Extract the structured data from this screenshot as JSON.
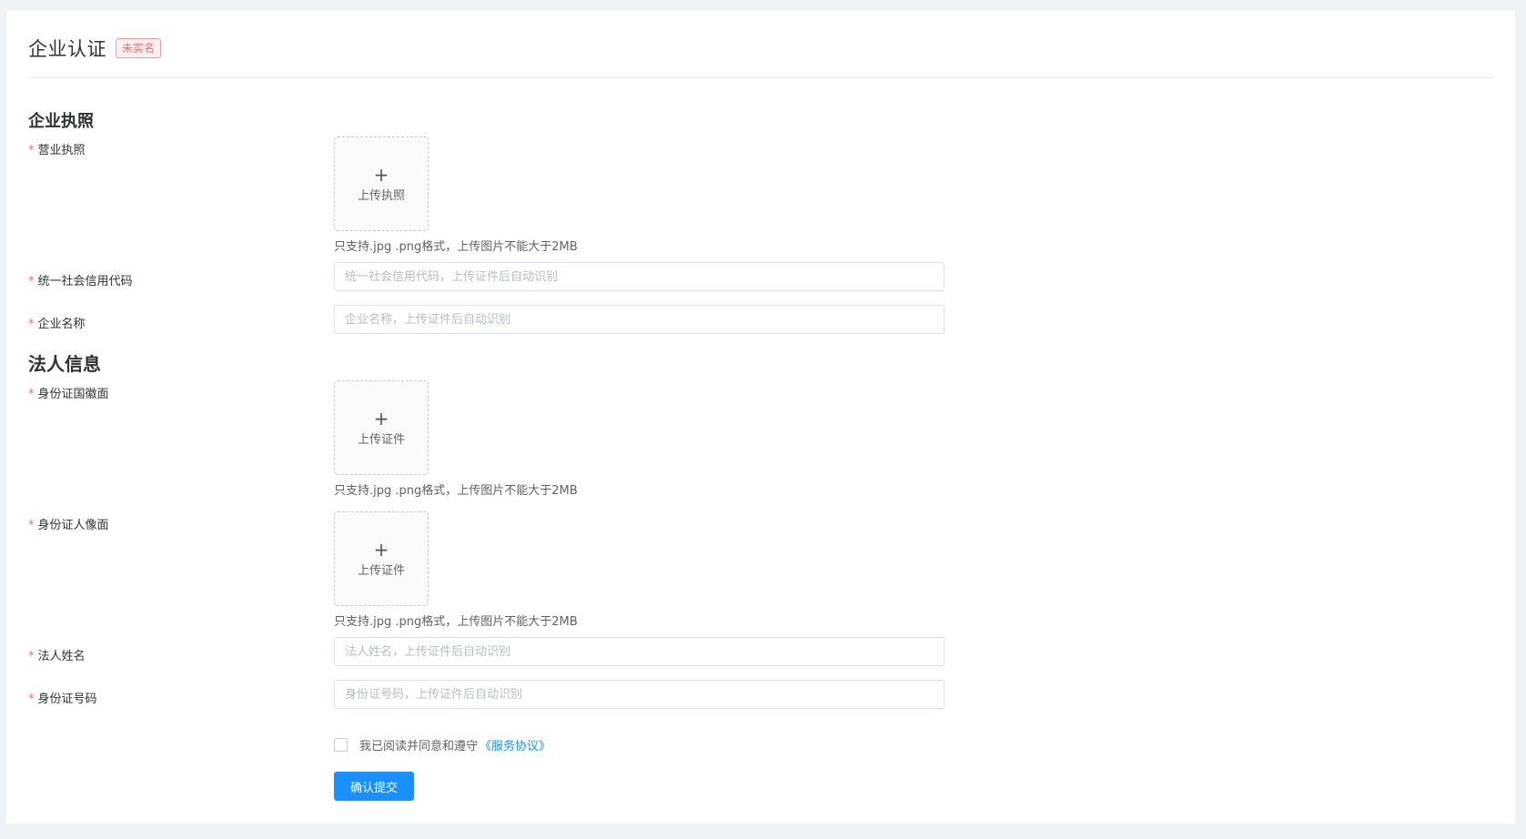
{
  "header": {
    "title": "企业认证",
    "status_badge": "未实名"
  },
  "sections": {
    "license_title": "企业执照",
    "legal_title": "法人信息"
  },
  "required_mark": "*",
  "fields": {
    "business_license": {
      "label": "营业执照",
      "upload_label": "上传执照",
      "tip": "只支持.jpg .png格式，上传图片不能大于2MB"
    },
    "credit_code": {
      "label": "统一社会信用代码",
      "placeholder": "统一社会信用代码，上传证件后自动识别",
      "value": ""
    },
    "company_name": {
      "label": "企业名称",
      "placeholder": "企业名称，上传证件后自动识别",
      "value": ""
    },
    "id_front": {
      "label": "身份证国徽面",
      "upload_label": "上传证件",
      "tip": "只支持.jpg .png格式，上传图片不能大于2MB"
    },
    "id_back": {
      "label": "身份证人像面",
      "upload_label": "上传证件",
      "tip": "只支持.jpg .png格式，上传图片不能大于2MB"
    },
    "legal_name": {
      "label": "法人姓名",
      "placeholder": "法人姓名，上传证件后自动识别",
      "value": ""
    },
    "id_number": {
      "label": "身份证号码",
      "placeholder": "身份证号码，上传证件后自动识别",
      "value": ""
    }
  },
  "upload_plus": "+",
  "agreement": {
    "text": "我已阅读并同意和遵守",
    "link": "《服务协议》",
    "checked": false
  },
  "submit_label": "确认提交",
  "colors": {
    "primary": "#1890ff",
    "required": "#f56c6c",
    "badge_text": "#f56c6c",
    "background": "#f0f2f5"
  }
}
